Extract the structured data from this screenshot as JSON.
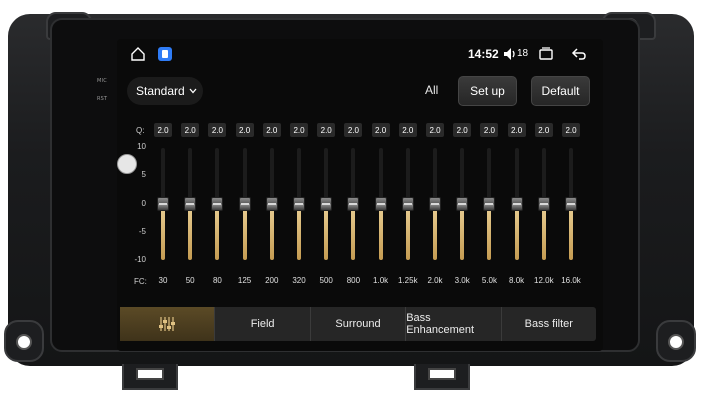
{
  "statusbar": {
    "time": "14:52",
    "volume_level": "18",
    "icons": [
      "home-icon",
      "app-icon",
      "volume-icon",
      "recent-apps-icon",
      "back-icon"
    ]
  },
  "device_labels": {
    "mic": "MIC",
    "rst": "RST"
  },
  "toolbar": {
    "mode_selected": "Standard",
    "all_label": "All",
    "setup_label": "Set up",
    "default_label": "Default"
  },
  "equalizer": {
    "q_label": "Q:",
    "fc_label": "FC:",
    "db_scale": [
      "10",
      "5",
      "0",
      "-5",
      "-10"
    ],
    "bands": [
      {
        "fc": "30",
        "q": "2.0",
        "gain": 0
      },
      {
        "fc": "50",
        "q": "2.0",
        "gain": 0
      },
      {
        "fc": "80",
        "q": "2.0",
        "gain": 0
      },
      {
        "fc": "125",
        "q": "2.0",
        "gain": 0
      },
      {
        "fc": "200",
        "q": "2.0",
        "gain": 0
      },
      {
        "fc": "320",
        "q": "2.0",
        "gain": 0
      },
      {
        "fc": "500",
        "q": "2.0",
        "gain": 0
      },
      {
        "fc": "800",
        "q": "2.0",
        "gain": 0
      },
      {
        "fc": "1.0k",
        "q": "2.0",
        "gain": 0
      },
      {
        "fc": "1.25k",
        "q": "2.0",
        "gain": 0
      },
      {
        "fc": "2.0k",
        "q": "2.0",
        "gain": 0
      },
      {
        "fc": "3.0k",
        "q": "2.0",
        "gain": 0
      },
      {
        "fc": "5.0k",
        "q": "2.0",
        "gain": 0
      },
      {
        "fc": "8.0k",
        "q": "2.0",
        "gain": 0
      },
      {
        "fc": "12.0k",
        "q": "2.0",
        "gain": 0
      },
      {
        "fc": "16.0k",
        "q": "2.0",
        "gain": 0
      }
    ]
  },
  "tabs": [
    {
      "label": "",
      "icon": "equalizer-sliders-icon",
      "active": true
    },
    {
      "label": "Field",
      "active": false
    },
    {
      "label": "Surround",
      "active": false
    },
    {
      "label": "Bass Enhancement",
      "active": false
    },
    {
      "label": "Bass filter",
      "active": false
    }
  ],
  "colors": {
    "accent_gold": "#e0c283",
    "active_tab": "#5b4a26",
    "screen_bg": "#0a0a0a"
  }
}
